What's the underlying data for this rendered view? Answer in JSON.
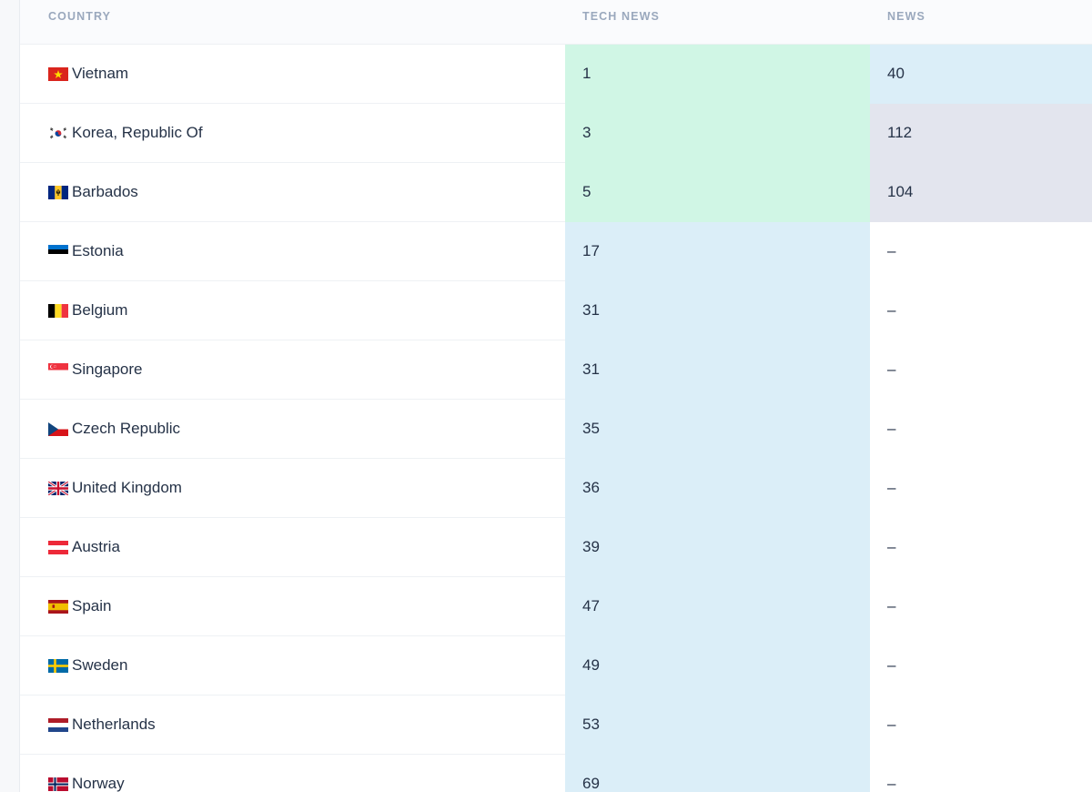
{
  "table": {
    "headers": {
      "country": "COUNTRY",
      "tech_news": "TECH NEWS",
      "news": "NEWS"
    },
    "rows": [
      {
        "country": "Vietnam",
        "flag": "vietnam-flag-icon",
        "tech_news": "1",
        "news": "40",
        "tech_bg": "#d0f6e5",
        "news_bg": "#dbeef8"
      },
      {
        "country": "Korea, Republic Of",
        "flag": "south-korea-flag-icon",
        "tech_news": "3",
        "news": "112",
        "tech_bg": "#d0f6e5",
        "news_bg": "#e3e5ee"
      },
      {
        "country": "Barbados",
        "flag": "barbados-flag-icon",
        "tech_news": "5",
        "news": "104",
        "tech_bg": "#d0f6e5",
        "news_bg": "#e3e5ee"
      },
      {
        "country": "Estonia",
        "flag": "estonia-flag-icon",
        "tech_news": "17",
        "news": "–",
        "tech_bg": "#dbeef8",
        "news_bg": "#ffffff"
      },
      {
        "country": "Belgium",
        "flag": "belgium-flag-icon",
        "tech_news": "31",
        "news": "–",
        "tech_bg": "#dbeef8",
        "news_bg": "#ffffff"
      },
      {
        "country": "Singapore",
        "flag": "singapore-flag-icon",
        "tech_news": "31",
        "news": "–",
        "tech_bg": "#dbeef8",
        "news_bg": "#ffffff"
      },
      {
        "country": "Czech Republic",
        "flag": "czech-republic-flag-icon",
        "tech_news": "35",
        "news": "–",
        "tech_bg": "#dbeef8",
        "news_bg": "#ffffff"
      },
      {
        "country": "United Kingdom",
        "flag": "united-kingdom-flag-icon",
        "tech_news": "36",
        "news": "–",
        "tech_bg": "#dbeef8",
        "news_bg": "#ffffff"
      },
      {
        "country": "Austria",
        "flag": "austria-flag-icon",
        "tech_news": "39",
        "news": "–",
        "tech_bg": "#dbeef8",
        "news_bg": "#ffffff"
      },
      {
        "country": "Spain",
        "flag": "spain-flag-icon",
        "tech_news": "47",
        "news": "–",
        "tech_bg": "#dbeef8",
        "news_bg": "#ffffff"
      },
      {
        "country": "Sweden",
        "flag": "sweden-flag-icon",
        "tech_news": "49",
        "news": "–",
        "tech_bg": "#dbeef8",
        "news_bg": "#ffffff"
      },
      {
        "country": "Netherlands",
        "flag": "netherlands-flag-icon",
        "tech_news": "53",
        "news": "–",
        "tech_bg": "#dbeef8",
        "news_bg": "#ffffff"
      },
      {
        "country": "Norway",
        "flag": "norway-flag-icon",
        "tech_news": "69",
        "news": "–",
        "tech_bg": "#dbeef8",
        "news_bg": "#ffffff"
      }
    ]
  },
  "colors": {
    "header_text": "#9aa8bd",
    "body_text": "#253247",
    "highlight_green": "#d0f6e5",
    "highlight_blue": "#dbeef8",
    "highlight_grey": "#e3e5ee"
  }
}
